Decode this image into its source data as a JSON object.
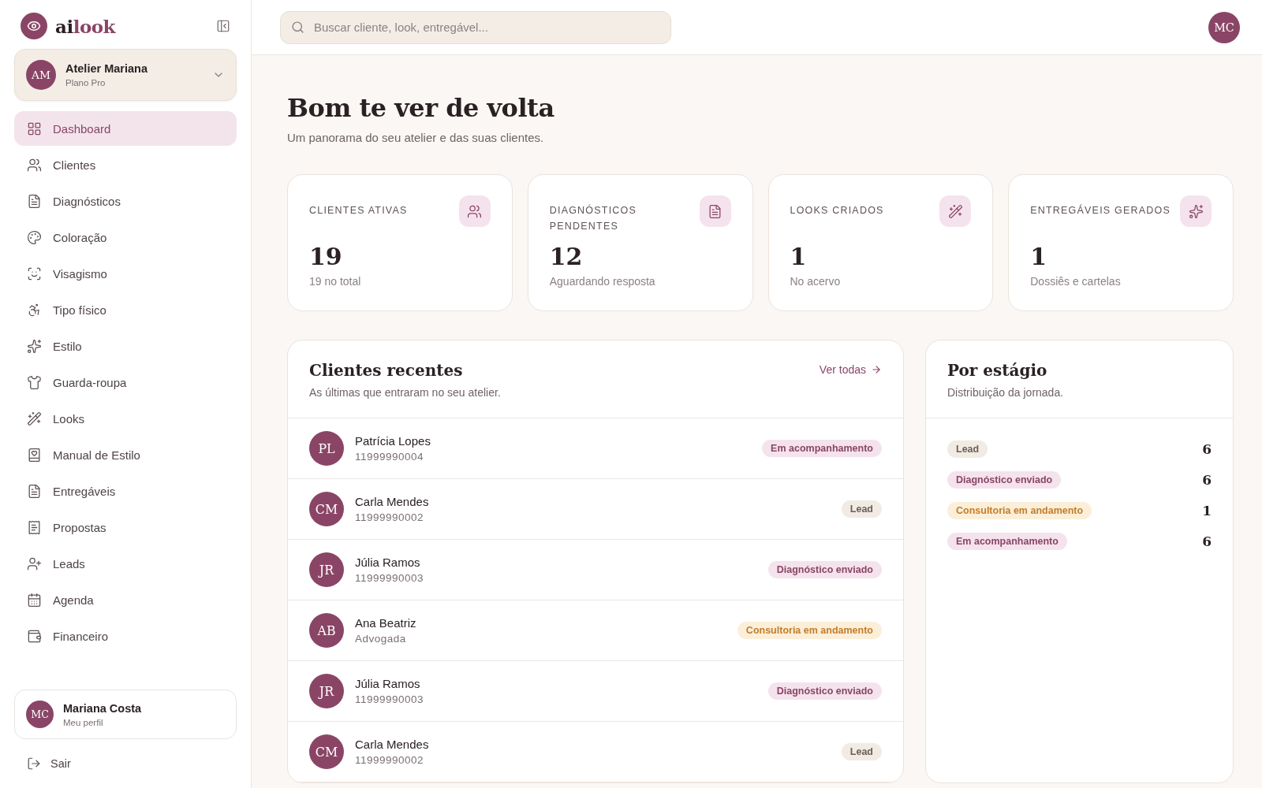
{
  "brand": {
    "name_dark": "ai",
    "name_accent": "look"
  },
  "workspace": {
    "initials": "AM",
    "name": "Atelier Mariana",
    "plan": "Plano Pro"
  },
  "nav": [
    {
      "label": "Dashboard",
      "selected": true
    },
    {
      "label": "Clientes",
      "selected": false
    },
    {
      "label": "Diagnósticos",
      "selected": false
    },
    {
      "label": "Coloração",
      "selected": false
    },
    {
      "label": "Visagismo",
      "selected": false
    },
    {
      "label": "Tipo físico",
      "selected": false
    },
    {
      "label": "Estilo",
      "selected": false
    },
    {
      "label": "Guarda-roupa",
      "selected": false
    },
    {
      "label": "Looks",
      "selected": false
    },
    {
      "label": "Manual de Estilo",
      "selected": false
    },
    {
      "label": "Entregáveis",
      "selected": false
    },
    {
      "label": "Propostas",
      "selected": false
    },
    {
      "label": "Leads",
      "selected": false
    },
    {
      "label": "Agenda",
      "selected": false
    },
    {
      "label": "Financeiro",
      "selected": false
    }
  ],
  "profile": {
    "initials": "MC",
    "name": "Mariana Costa",
    "subtitle": "Meu perfil"
  },
  "logout": "Sair",
  "search": {
    "placeholder": "Buscar cliente, look, entregável..."
  },
  "user_initials": "MC",
  "page": {
    "title": "Bom te ver de volta",
    "subtitle": "Um panorama do seu atelier e das suas clientes."
  },
  "stats": [
    {
      "label": "CLIENTES ATIVAS",
      "value": "19",
      "note": "19 no total"
    },
    {
      "label": "DIAGNÓSTICOS PENDENTES",
      "value": "12",
      "note": "Aguardando resposta"
    },
    {
      "label": "LOOKS CRIADOS",
      "value": "1",
      "note": "No acervo"
    },
    {
      "label": "ENTREGÁVEIS GERADOS",
      "value": "1",
      "note": "Dossiês e cartelas"
    }
  ],
  "recent": {
    "title": "Clientes recentes",
    "subtitle": "As últimas que entraram no seu atelier.",
    "link": "Ver todas",
    "rows": [
      {
        "initials": "PL",
        "name": "Patrícia Lopes",
        "detail": "11999990004",
        "status": "Em acompanhamento",
        "kind": "following"
      },
      {
        "initials": "CM",
        "name": "Carla Mendes",
        "detail": "11999990002",
        "status": "Lead",
        "kind": "lead"
      },
      {
        "initials": "JR",
        "name": "Júlia Ramos",
        "detail": "11999990003",
        "status": "Diagnóstico enviado",
        "kind": "diagnostic"
      },
      {
        "initials": "AB",
        "name": "Ana Beatriz",
        "detail": "Advogada",
        "status": "Consultoria em andamento",
        "kind": "consulting"
      },
      {
        "initials": "JR",
        "name": "Júlia Ramos",
        "detail": "11999990003",
        "status": "Diagnóstico enviado",
        "kind": "diagnostic"
      },
      {
        "initials": "CM",
        "name": "Carla Mendes",
        "detail": "11999990002",
        "status": "Lead",
        "kind": "lead"
      }
    ]
  },
  "stages": {
    "title": "Por estágio",
    "subtitle": "Distribuição da jornada.",
    "items": [
      {
        "label": "Lead",
        "kind": "lead",
        "count": "6"
      },
      {
        "label": "Diagnóstico enviado",
        "kind": "diagnostic",
        "count": "6"
      },
      {
        "label": "Consultoria em andamento",
        "kind": "consulting",
        "count": "1"
      },
      {
        "label": "Em acompanhamento",
        "kind": "following",
        "count": "6"
      }
    ]
  }
}
